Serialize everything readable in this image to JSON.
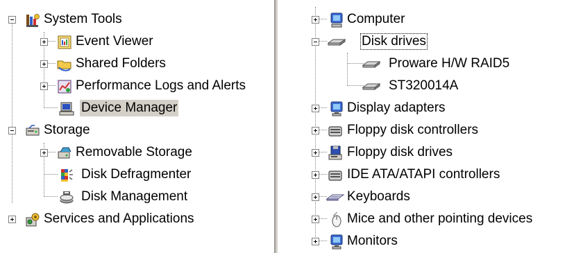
{
  "left_tree": {
    "system_tools": {
      "label": "System Tools",
      "children": {
        "event_viewer": "Event Viewer",
        "shared_folders": "Shared Folders",
        "performance_logs": "Performance Logs and Alerts",
        "device_manager": "Device Manager"
      }
    },
    "storage": {
      "label": "Storage",
      "children": {
        "removable_storage": "Removable Storage",
        "disk_defragmenter": "Disk Defragmenter",
        "disk_management": "Disk Management"
      }
    },
    "services_apps": "Services and Applications",
    "selected": "Device Manager"
  },
  "right_tree": {
    "computer": "Computer",
    "disk_drives": {
      "label": "Disk drives",
      "children": [
        "Proware H/W RAID5",
        "ST320014A"
      ]
    },
    "display_adapters": "Display adapters",
    "floppy_controllers": "Floppy disk controllers",
    "floppy_drives": "Floppy disk drives",
    "ide_controllers": "IDE ATA/ATAPI controllers",
    "keyboards": "Keyboards",
    "mice": "Mice and other pointing devices",
    "monitors": "Monitors",
    "focused": "Disk drives"
  },
  "colors": {
    "selection_bg": "#d4d0c8",
    "tree_line": "#808080",
    "splitter": "#9a9a9a"
  }
}
